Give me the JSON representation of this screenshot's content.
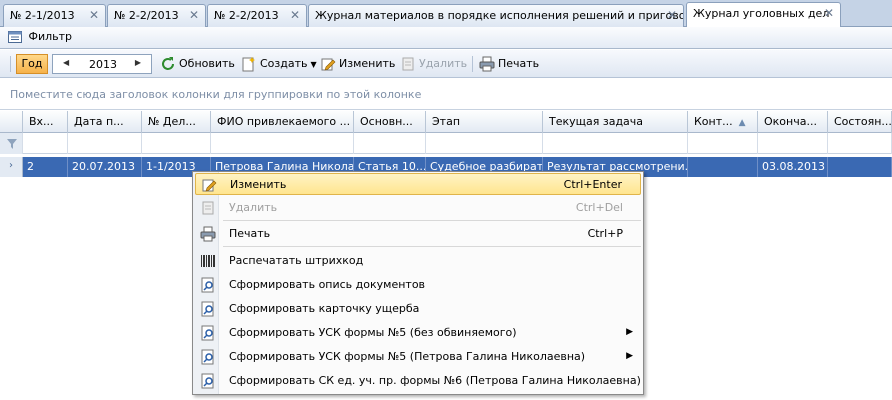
{
  "tabs": [
    {
      "label": "№ 2-1/2013"
    },
    {
      "label": "№ 2-2/2013"
    },
    {
      "label": "№ 2-2/2013"
    },
    {
      "label": "Журнал материалов в порядке исполнения решений и приговоров"
    },
    {
      "label": "Журнал уголовных дел"
    }
  ],
  "filter": {
    "label": "Фильтр"
  },
  "toolbar": {
    "year_label": "Год",
    "year_value": "2013",
    "refresh": "Обновить",
    "create": "Создать",
    "edit": "Изменить",
    "delete": "Удалить",
    "print": "Печать"
  },
  "group_hint": "Поместите сюда заголовок колонки для группировки по этой колонке",
  "columns": [
    "Вх...",
    "Дата п...",
    "№ Дел...",
    "ФИО привлекаемого ...",
    "Основн...",
    "Этап",
    "Текущая задача",
    "Конт...",
    "Оконча...",
    "Состоян..."
  ],
  "row": [
    "2",
    "20.07.2013",
    "1-1/2013",
    "Петрова Галина Никола...",
    "Статья 10...",
    "Судебное разбират...",
    "Результат рассмотрени...",
    "",
    "03.08.2013",
    ""
  ],
  "menu": [
    {
      "label": "Изменить",
      "shortcut": "Ctrl+Enter",
      "icon": "edit-icon"
    },
    {
      "label": "Удалить",
      "shortcut": "Ctrl+Del",
      "icon": "delete-icon"
    },
    {
      "label": "Печать",
      "shortcut": "Ctrl+P",
      "icon": "print-icon"
    },
    {
      "label": "Распечатать штрихкод",
      "shortcut": "",
      "icon": "barcode-icon"
    },
    {
      "label": "Сформировать опись документов",
      "shortcut": "",
      "icon": "report-icon"
    },
    {
      "label": "Сформировать карточку ущерба",
      "shortcut": "",
      "icon": "report-icon"
    },
    {
      "label": "Сформировать УСК формы №5 (без обвиняемого)",
      "shortcut": "",
      "icon": "report-icon"
    },
    {
      "label": "Сформировать УСК формы №5 (Петрова Галина Николаевна)",
      "shortcut": "",
      "icon": "report-icon"
    },
    {
      "label": "Сформировать СК ед. уч. пр. формы №6 (Петрова Галина Николаевна)",
      "shortcut": "",
      "icon": "report-icon"
    }
  ],
  "colors": {
    "accent": "#3a69b3",
    "highlight": "#ffe58f"
  }
}
